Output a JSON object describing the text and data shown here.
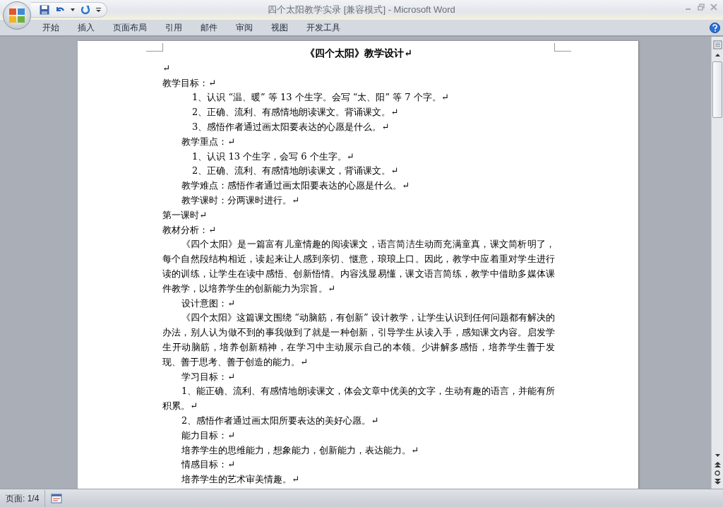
{
  "window": {
    "title": "四个太阳教学实录 [兼容模式] - Microsoft Word"
  },
  "ribbon_tabs": [
    {
      "label": "开始"
    },
    {
      "label": "插入"
    },
    {
      "label": "页面布局"
    },
    {
      "label": "引用"
    },
    {
      "label": "邮件"
    },
    {
      "label": "审阅"
    },
    {
      "label": "视图"
    },
    {
      "label": "开发工具"
    }
  ],
  "document": {
    "paragraphs": [
      {
        "kind": "title",
        "text": "《四个太阳》教学设计↵"
      },
      {
        "kind": "plain",
        "text": "↵"
      },
      {
        "kind": "plain",
        "text": "教学目标：↵"
      },
      {
        "kind": "deep",
        "text": "1、认识 “温、暖” 等 13 个生字。会写 “太、阳” 等 7 个字。↵"
      },
      {
        "kind": "deep",
        "text": "2、正确、流利、有感情地朗读课文。背诵课文。↵"
      },
      {
        "kind": "deep",
        "text": "3、感悟作者通过画太阳要表达的心愿是什么。↵"
      },
      {
        "kind": "indent",
        "text": "教学重点：↵"
      },
      {
        "kind": "deep",
        "text": "1、认识 13 个生字，会写 6 个生字。↵"
      },
      {
        "kind": "deep",
        "text": "2、正确、流利、有感情地朗读课文，背诵课文。↵"
      },
      {
        "kind": "indent",
        "text": "教学难点：感悟作者通过画太阳要表达的心愿是什么。↵"
      },
      {
        "kind": "indent",
        "text": "教学课时：分两课时进行。↵"
      },
      {
        "kind": "plain",
        "text": "第一课时↵"
      },
      {
        "kind": "plain",
        "text": "教材分析：↵"
      },
      {
        "kind": "first-line",
        "text": "《四个太阳》是一篇富有儿童情趣的阅读课文，语言简洁生动而充满童真，课文简析明了，每个自然段结构相近，读起来让人感到亲切、惬意，琅琅上口。因此，教学中应着重对学生进行读的训练，让学生在读中感悟、创新悟情。内容浅显易懂，课文语言简练，教学中借助多媒体课件教学，以培养学生的创新能力为宗旨。↵"
      },
      {
        "kind": "indent",
        "text": "设计意图：↵"
      },
      {
        "kind": "first-line",
        "text": "《四个太阳》这篇课文围绕 “动脑筋，有创新” 设计教学，让学生认识到任何问题都有解决的办法，别人认为做不到的事我做到了就是一种创新，引导学生从读入手，感知课文内容。启发学生开动脑筋，培养创新精神，在学习中主动展示自己的本领。少讲解多感悟，培养学生善于发现、善于思考、善于创造的能力。↵"
      },
      {
        "kind": "indent",
        "text": "学习目标：↵"
      },
      {
        "kind": "first-line",
        "text": "1、能正确、流利、有感情地朗读课文，体会文章中优美的文字，生动有趣的语言，并能有所积累。↵"
      },
      {
        "kind": "indent",
        "text": "2、感悟作者通过画太阳所要表达的美好心愿。↵"
      },
      {
        "kind": "indent",
        "text": "能力目标：↵"
      },
      {
        "kind": "indent",
        "text": "培养学生的思维能力，想象能力，创新能力，表达能力。↵"
      },
      {
        "kind": "indent",
        "text": "情感目标：↵"
      },
      {
        "kind": "indent",
        "text": "培养学生的艺术审美情趣。↵"
      }
    ]
  },
  "status_bar": {
    "page": "页面: 1/4"
  }
}
